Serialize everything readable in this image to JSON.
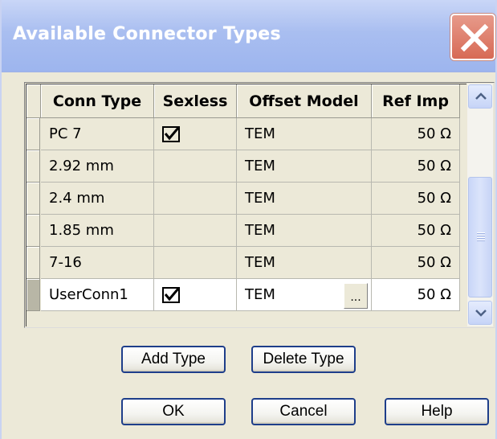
{
  "window": {
    "title": "Available Connector Types",
    "close_icon": "close-x-icon"
  },
  "grid": {
    "columns": [
      "Conn Type",
      "Sexless",
      "Offset Model",
      "Ref Imp"
    ],
    "rows": [
      {
        "conn_type": "PC 7",
        "sexless": true,
        "offset_model": "TEM",
        "ref_imp": "50 Ω",
        "current": false
      },
      {
        "conn_type": "2.92 mm",
        "sexless": false,
        "offset_model": "TEM",
        "ref_imp": "50 Ω",
        "current": false
      },
      {
        "conn_type": "2.4 mm",
        "sexless": false,
        "offset_model": "TEM",
        "ref_imp": "50 Ω",
        "current": false
      },
      {
        "conn_type": "1.85 mm",
        "sexless": false,
        "offset_model": "TEM",
        "ref_imp": "50 Ω",
        "current": false
      },
      {
        "conn_type": "7-16",
        "sexless": false,
        "offset_model": "TEM",
        "ref_imp": "50 Ω",
        "current": false
      },
      {
        "conn_type": "UserConn1",
        "sexless": true,
        "offset_model": "TEM",
        "ref_imp": "50 Ω",
        "current": true
      }
    ],
    "ellipsis_label": "...",
    "scroll_position": 0.55
  },
  "buttons": {
    "add_type": "Add Type",
    "delete_type": "Delete Type",
    "ok": "OK",
    "cancel": "Cancel",
    "help": "Help"
  },
  "colors": {
    "title_gradient": "#a9bef0",
    "close_button": "#d76a55",
    "dialog_bg": "#ece9d8",
    "button_border": "#1e3e8a"
  }
}
